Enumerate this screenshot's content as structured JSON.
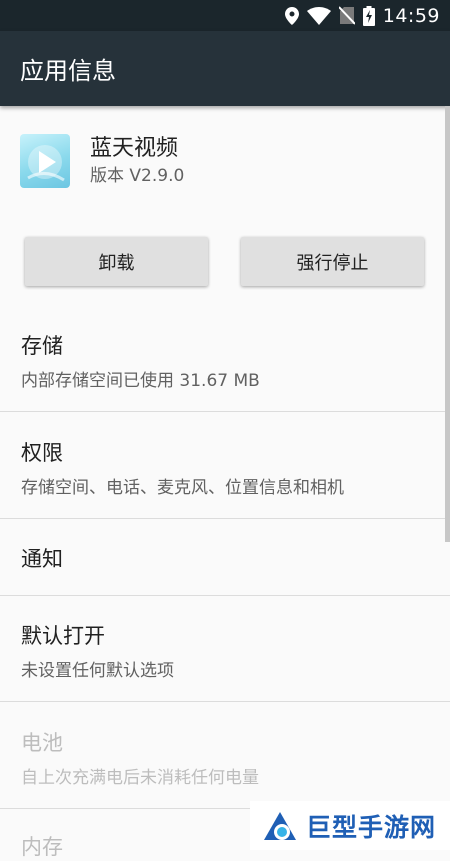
{
  "status_bar": {
    "time": "14:59",
    "icons": [
      "location-icon",
      "wifi-icon",
      "no-sim-icon",
      "battery-charging-icon"
    ]
  },
  "app_bar": {
    "title": "应用信息"
  },
  "app": {
    "name": "蓝天视频",
    "version": "版本 V2.9.0"
  },
  "buttons": {
    "uninstall": "卸载",
    "force_stop": "强行停止"
  },
  "sections": {
    "storage": {
      "title": "存储",
      "subtitle": "内部存储空间已使用 31.67 MB"
    },
    "permissions": {
      "title": "权限",
      "subtitle": "存储空间、电话、麦克风、位置信息和相机"
    },
    "notifications": {
      "title": "通知"
    },
    "open_by_default": {
      "title": "默认打开",
      "subtitle": "未设置任何默认选项"
    },
    "battery": {
      "title": "电池",
      "subtitle": "自上次充满电后未消耗任何电量"
    },
    "memory": {
      "title": "内存"
    }
  },
  "watermark": {
    "text": "巨型手游网"
  },
  "colors": {
    "status_bar": "#1b262c",
    "app_bar": "#26323a",
    "background": "#fafafa",
    "button": "#e0e0e0",
    "watermark_blue": "#1f5fb5"
  }
}
